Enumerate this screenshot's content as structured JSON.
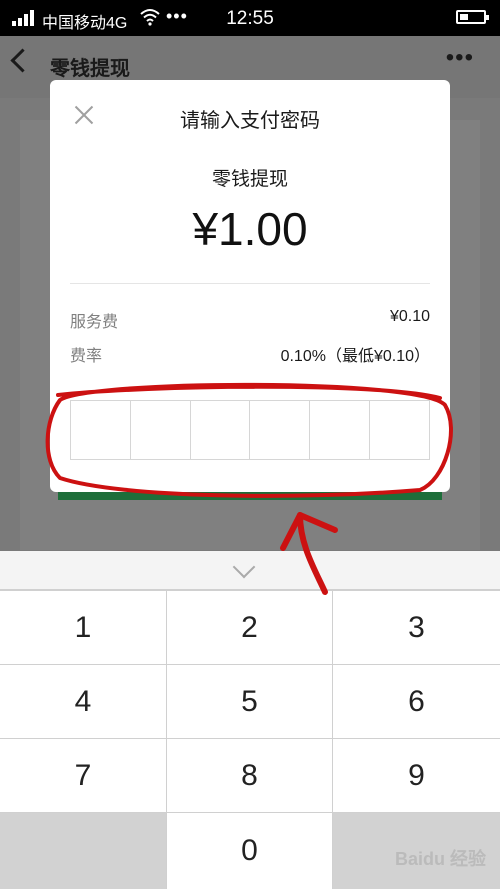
{
  "status_bar": {
    "carrier": "中国移动4G",
    "dots": "•••",
    "time": "12:55"
  },
  "nav": {
    "title": "零钱提现",
    "more": "•••"
  },
  "dialog": {
    "title": "请输入支付密码",
    "subject": "零钱提现",
    "amount": "¥1.00",
    "fee_label": "服务费",
    "fee_value": "¥0.10",
    "rate_label": "费率",
    "rate_value": "0.10%（最低¥0.10）",
    "password_cells": 6
  },
  "keyboard": {
    "keys": [
      "1",
      "2",
      "3",
      "4",
      "5",
      "6",
      "7",
      "8",
      "9",
      "",
      "0",
      ""
    ]
  },
  "watermark": "Baidu 经验",
  "colors": {
    "accent_green": "#1e6e3a",
    "annotation_red": "#cc1111"
  }
}
